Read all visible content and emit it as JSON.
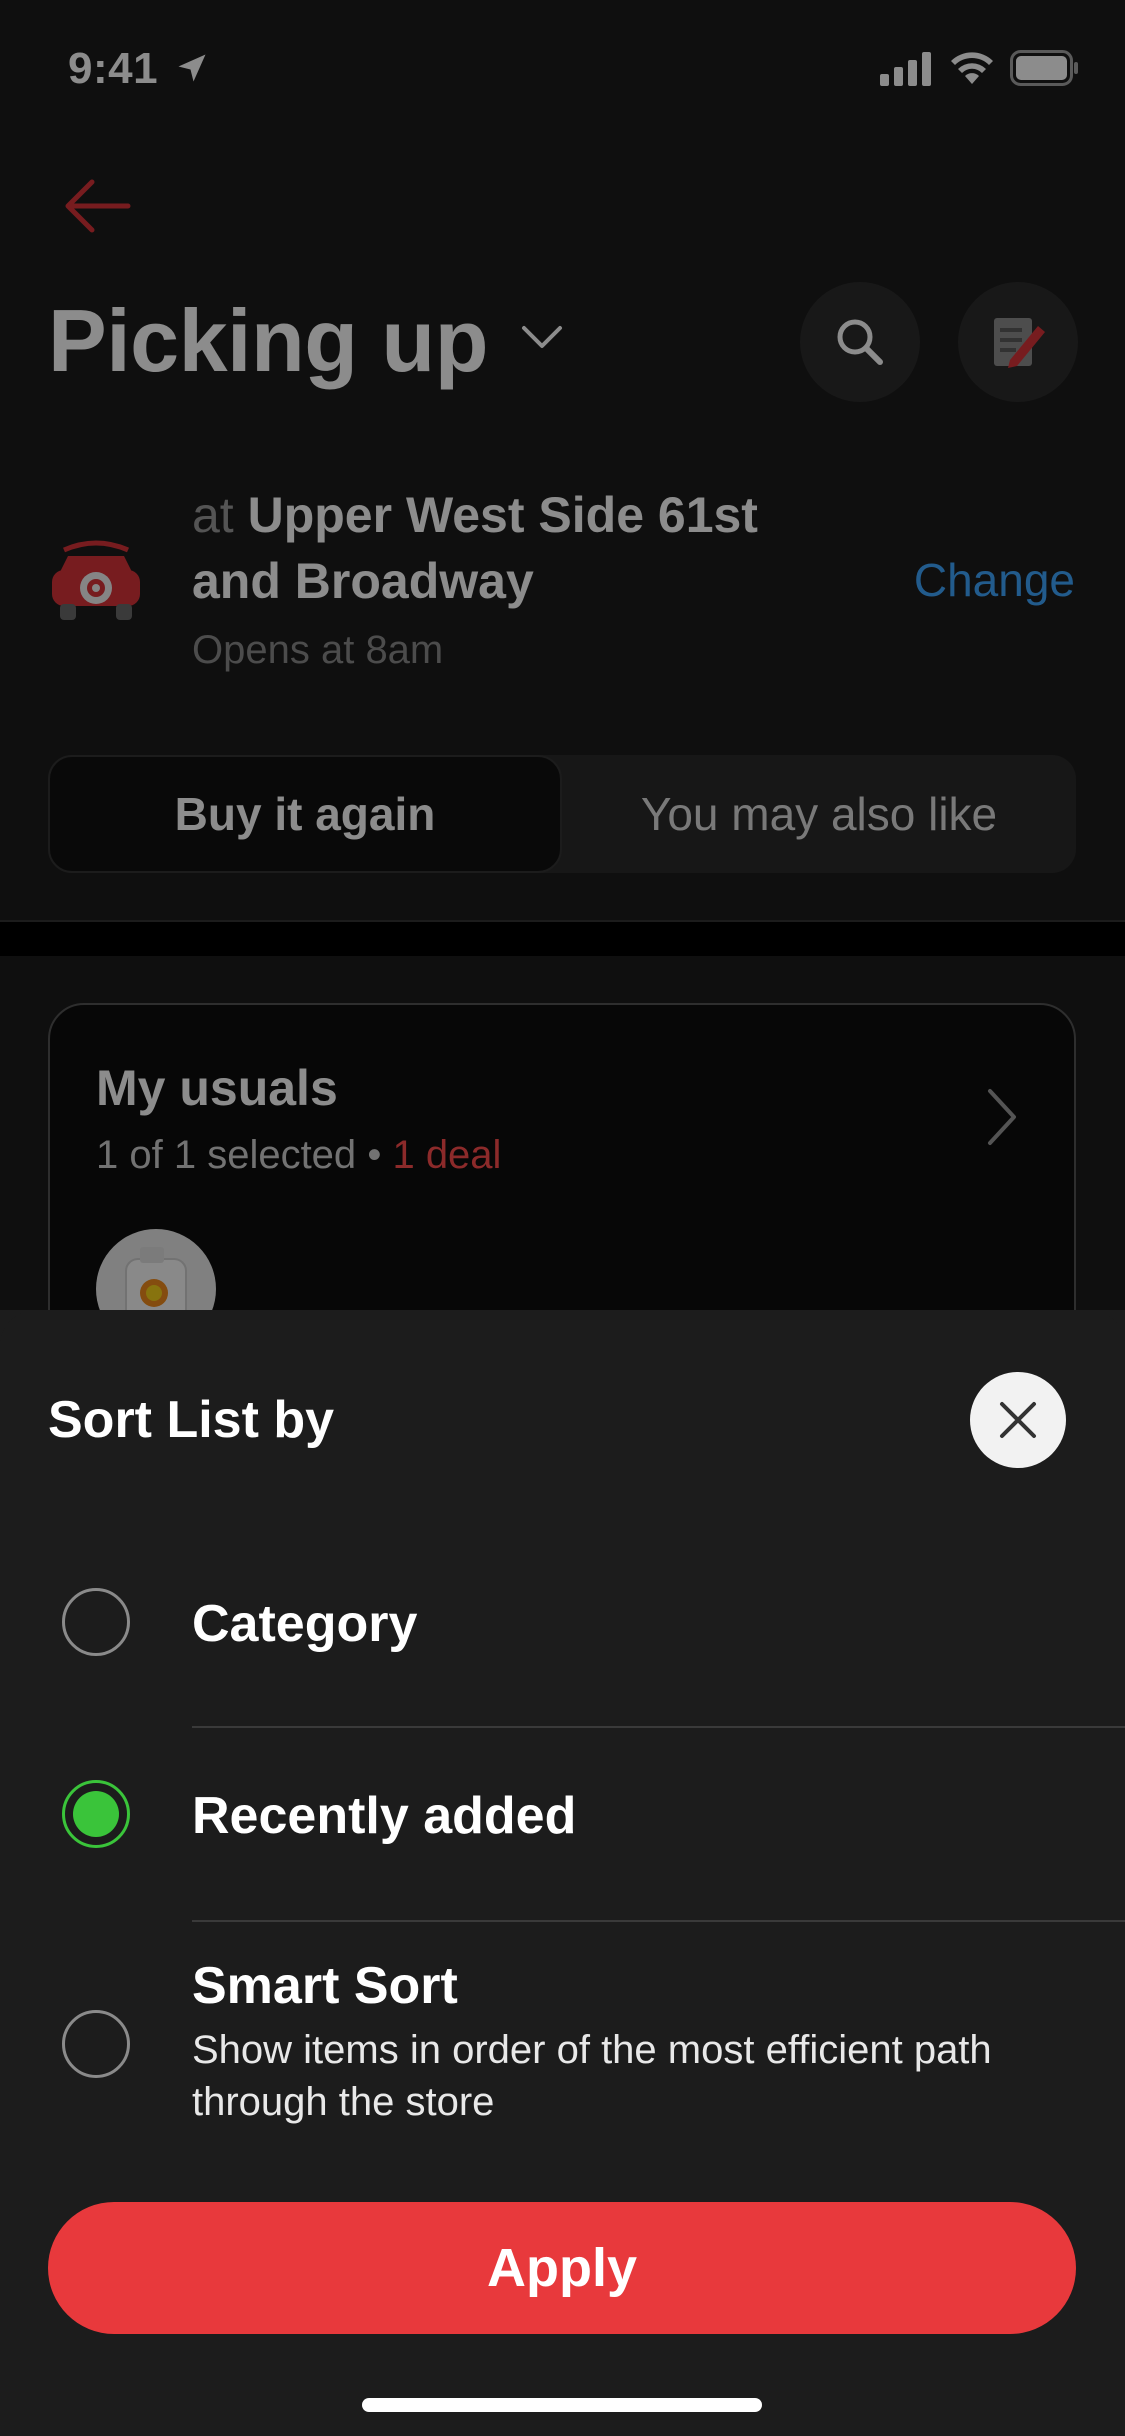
{
  "status_bar": {
    "time": "9:41",
    "location_icon": "location-arrow-icon",
    "signal_icon": "cellular-signal-icon",
    "wifi_icon": "wifi-icon",
    "battery_icon": "battery-full-icon"
  },
  "header": {
    "back_icon": "back-arrow-icon",
    "title": "Picking up",
    "title_chevron_icon": "chevron-down-icon",
    "search_icon": "search-icon",
    "list_icon": "shopping-list-edit-icon"
  },
  "store": {
    "icon": "curbside-car-icon",
    "prefix": "at",
    "name_line1": "Upper West Side 61st",
    "name_line2": "and Broadway",
    "hours": "Opens at 8am",
    "change_label": "Change"
  },
  "segmented": {
    "tabs": [
      {
        "label": "Buy it again",
        "active": true
      },
      {
        "label": "You may also like",
        "active": false
      }
    ]
  },
  "usuals": {
    "title": "My usuals",
    "selected_text": "1 of 1 selected",
    "separator": "•",
    "deal_text": "1 deal",
    "chevron_icon": "chevron-right-icon"
  },
  "sheet": {
    "title": "Sort List by",
    "close_icon": "close-icon",
    "options": [
      {
        "label": "Category",
        "selected": false
      },
      {
        "label": "Recently added",
        "selected": true
      },
      {
        "label": "Smart Sort",
        "description": "Show items in order of the most efficient path through the store",
        "selected": false
      }
    ],
    "apply_label": "Apply"
  },
  "colors": {
    "accent_red": "#e8393c",
    "selected_green": "#3ac43a",
    "link_blue": "#3ea6ff",
    "deal_red": "#ff4d4d"
  }
}
